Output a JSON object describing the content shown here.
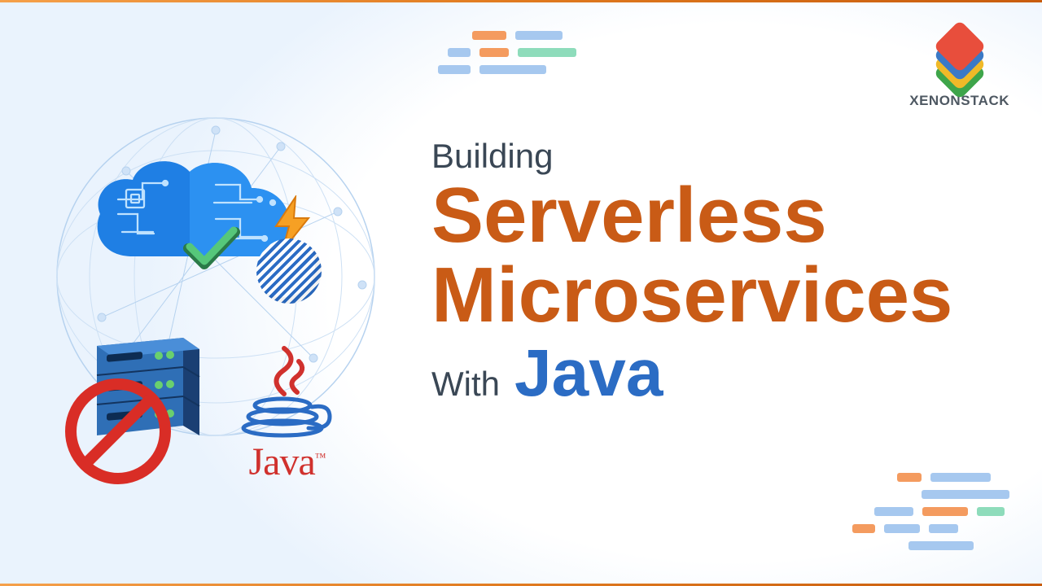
{
  "brand": {
    "name": "XENONSTACK"
  },
  "title": {
    "line1": "Building",
    "line2": "Serverless",
    "line3": "Microservices",
    "line4_prefix": "With",
    "line4_emph": "Java"
  },
  "illustration": {
    "java_label": "Java",
    "java_tm": "™"
  },
  "colors": {
    "accent_orange": "#c95b16",
    "accent_blue": "#2b6cc4",
    "text_dark": "#3a4755"
  }
}
